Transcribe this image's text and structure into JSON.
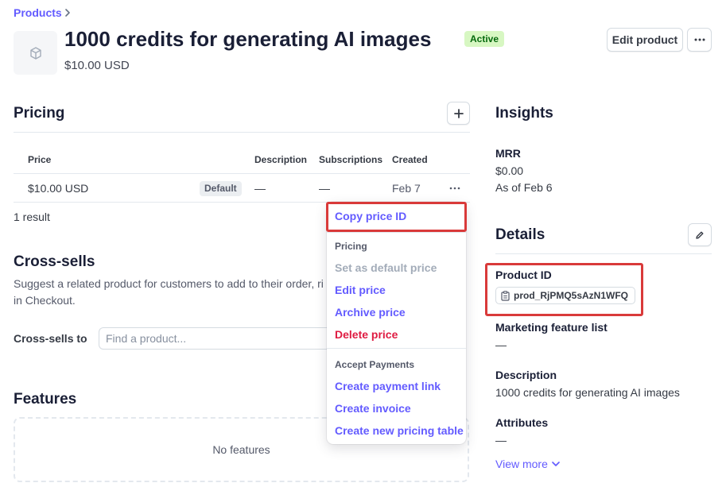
{
  "breadcrumb": {
    "label": "Products"
  },
  "product": {
    "title": "1000 credits for generating AI images",
    "status": "Active",
    "price": "$10.00 USD",
    "image_icon": "cube-icon"
  },
  "header_actions": {
    "edit_label": "Edit product",
    "more_icon": "ellipsis-icon"
  },
  "pricing": {
    "title": "Pricing",
    "add_icon": "plus-icon",
    "columns": [
      "Price",
      "Description",
      "Subscriptions",
      "Created"
    ],
    "rows": [
      {
        "price": "$10.00 USD",
        "badge": "Default",
        "description": "—",
        "subscriptions": "—",
        "created": "Feb 7"
      }
    ],
    "result_count": "1 result"
  },
  "cross_sells": {
    "title": "Cross-sells",
    "description_line1": "Suggest a related product for customers to add to their order, ri",
    "description_line2": "in Checkout.",
    "field_label": "Cross-sells to",
    "input_placeholder": "Find a product..."
  },
  "features": {
    "title": "Features",
    "empty_text": "No features"
  },
  "context_menu": {
    "copy_id": "Copy price ID",
    "pricing_heading": "Pricing",
    "set_default": "Set as default price",
    "edit_price": "Edit price",
    "archive_price": "Archive price",
    "delete_price": "Delete price",
    "accept_heading": "Accept Payments",
    "create_payment_link": "Create payment link",
    "create_invoice": "Create invoice",
    "create_pricing_table": "Create new pricing table"
  },
  "insights": {
    "title": "Insights",
    "mrr_label": "MRR",
    "mrr_value": "$0.00",
    "mrr_asof": "As of Feb 6"
  },
  "details": {
    "title": "Details",
    "edit_icon": "pencil-icon",
    "product_id_label": "Product ID",
    "product_id_value": "prod_RjPMQ5sAzN1WFQ",
    "marketing_label": "Marketing feature list",
    "marketing_value": "—",
    "description_label": "Description",
    "description_value": "1000 credits for generating AI images",
    "attributes_label": "Attributes",
    "attributes_value": "—",
    "view_more": "View more"
  },
  "colors": {
    "accent": "#635bff",
    "danger": "#df1b41",
    "highlight": "#d93a3a",
    "active_bg": "#d7f7c2"
  }
}
